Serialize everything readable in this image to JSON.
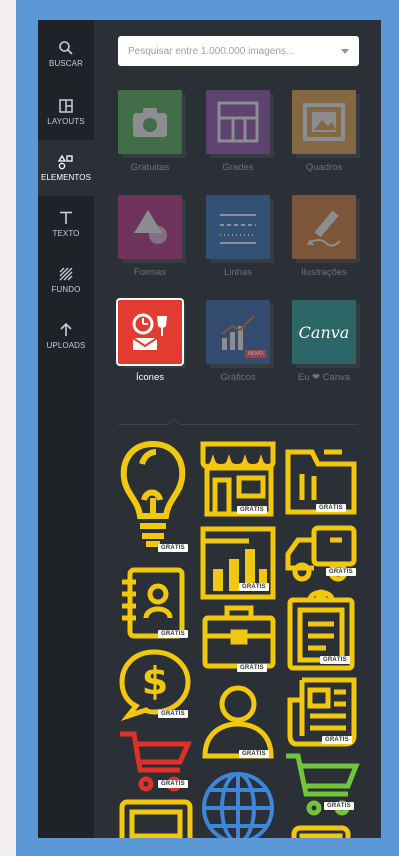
{
  "sidebar": {
    "items": [
      {
        "label": "BUSCAR",
        "icon": "search-icon"
      },
      {
        "label": "LAYOUTS",
        "icon": "layouts-icon"
      },
      {
        "label": "ELEMENTOS",
        "icon": "elements-icon",
        "active": true
      },
      {
        "label": "TEXTO",
        "icon": "text-icon"
      },
      {
        "label": "FUNDO",
        "icon": "background-icon"
      },
      {
        "label": "UPLOADS",
        "icon": "upload-icon"
      }
    ]
  },
  "search": {
    "placeholder": "Pesquisar entre 1.000.000 imagens..."
  },
  "categories": [
    {
      "label": "Gratuitas",
      "color": "#5cb85c"
    },
    {
      "label": "Grades",
      "color": "#9b59b6"
    },
    {
      "label": "Quadros",
      "color": "#f0ad4e"
    },
    {
      "label": "Formas",
      "color": "#c0398a"
    },
    {
      "label": "Linhas",
      "color": "#3a7bbf"
    },
    {
      "label": "Ilustrações",
      "color": "#e0843a"
    },
    {
      "label": "Ícones",
      "color": "#e23b2f",
      "active": true
    },
    {
      "label": "Gráficos",
      "color": "#3d6fb6",
      "tag": "NOVO"
    },
    {
      "label": "Eu ❤ Canva",
      "color": "#2fa8a0",
      "logo": "Canva"
    }
  ],
  "icons": {
    "badge_label": "GRÁTIS",
    "items": [
      "lightbulb-icon",
      "storefront-icon",
      "folder-icon",
      "bar-chart-icon",
      "truck-icon",
      "contacts-book-icon",
      "briefcase-icon",
      "clipboard-icon",
      "dollar-bubble-icon",
      "user-icon",
      "newspaper-icon",
      "red-cart-icon",
      "globe-icon",
      "green-cart-icon",
      "monitor-icon",
      "tablet-icon"
    ],
    "colors": {
      "yellow": "#f2c80f",
      "red": "#e0302a",
      "blue": "#3d86d8",
      "green": "#72c43a"
    }
  }
}
